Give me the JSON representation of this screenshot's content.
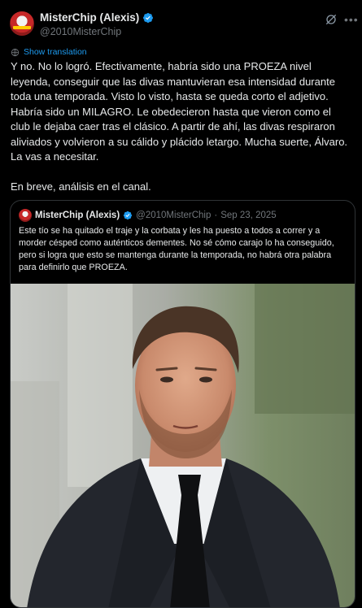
{
  "author": {
    "display_name": "MisterChip (Alexis)",
    "handle": "@2010MisterChip"
  },
  "translate": {
    "label": "Show translation"
  },
  "tweet": {
    "paragraphs": [
      "Y no. No lo logró. Efectivamente, habría sido una PROEZA nivel leyenda, conseguir que las divas mantuvieran esa intensidad durante toda una temporada. Visto lo visto, hasta se queda corto el adjetivo. Habría sido un MILAGRO. Le obedecieron hasta que vieron como el club le dejaba caer tras el clásico. A partir de ahí, las divas respiraron aliviados y volvieron a su cálido y plácido letargo. Mucha suerte, Álvaro. La vas a necesitar.",
      "En breve, análisis en el canal."
    ]
  },
  "quoted": {
    "display_name": "MisterChip (Alexis)",
    "handle": "@2010MisterChip",
    "separator": "·",
    "date": "Sep 23, 2025",
    "text": "Este tío se ha quitado el traje y la corbata y les ha puesto a todos a correr y a morder césped como auténticos dementes. No sé cómo carajo lo ha conseguido, pero si logra que esto se mantenga durante la temporada, no habrá otra palabra para definirlo que PROEZA."
  },
  "icons": {
    "verified": "verified-badge-icon",
    "grok": "grok-icon",
    "more": "more-icon",
    "translate": "globe-icon"
  },
  "colors": {
    "background": "#000000",
    "text": "#e7e9ea",
    "muted": "#71767b",
    "accent": "#1d9bf0",
    "border": "#2f3336"
  }
}
